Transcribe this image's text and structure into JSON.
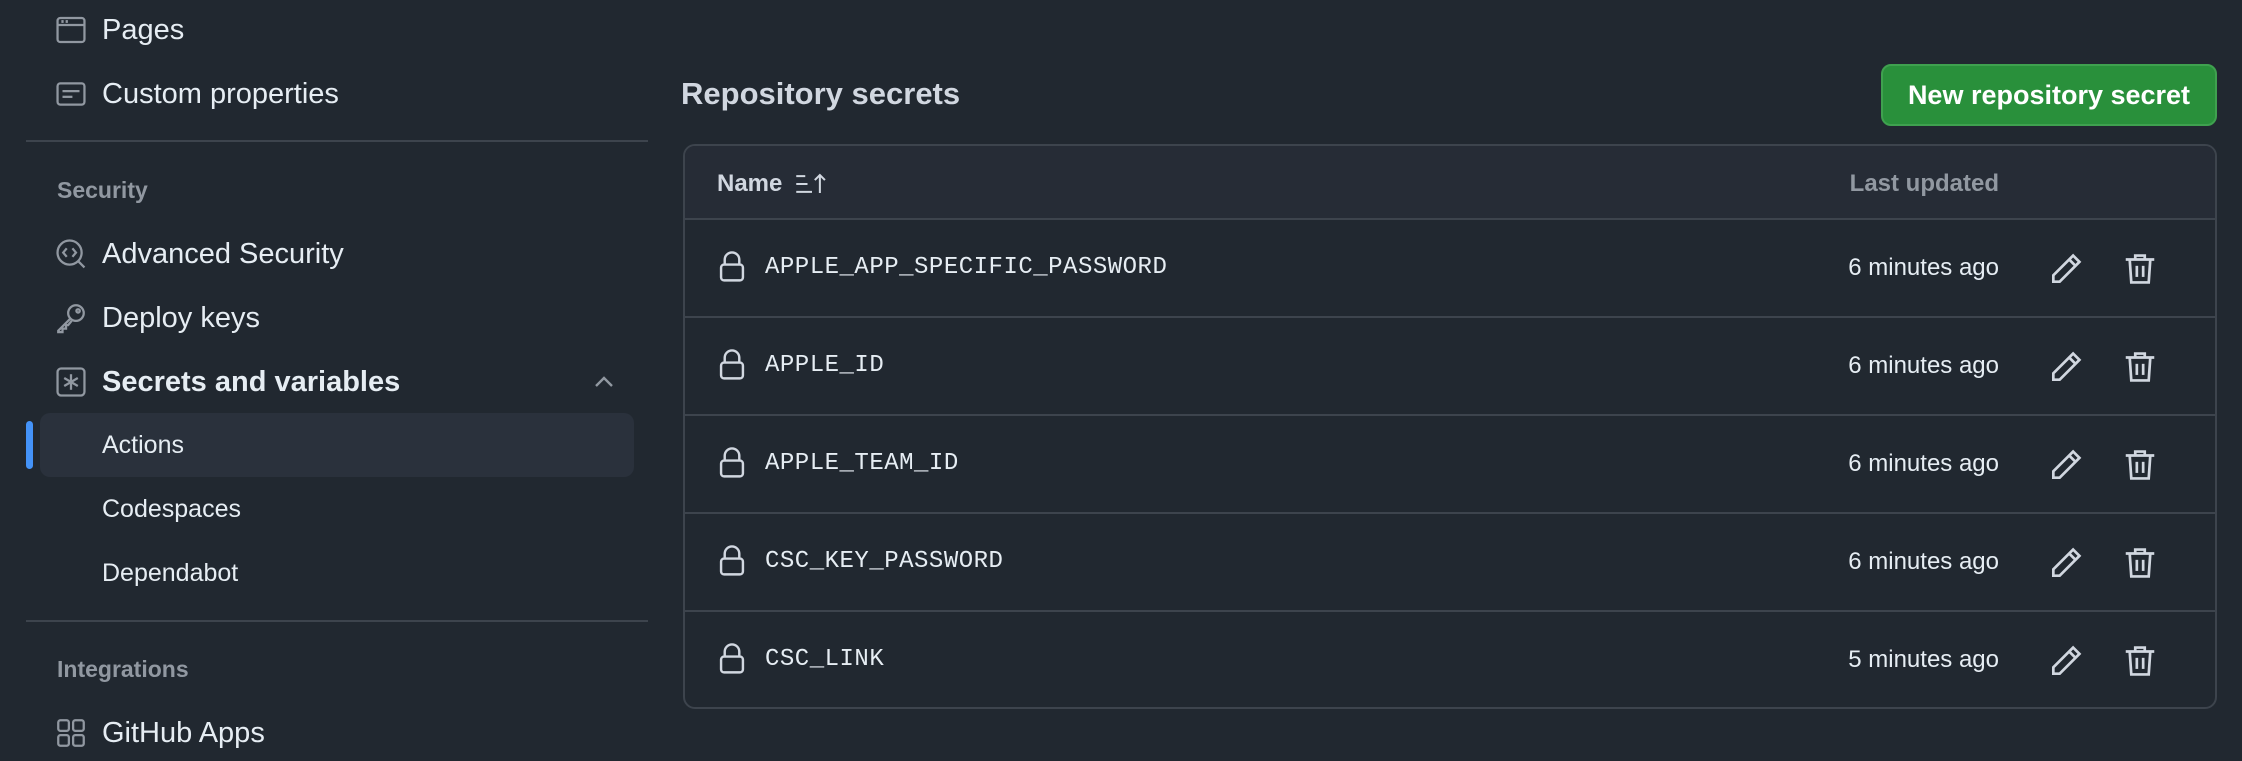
{
  "sidebar": {
    "items_top": [
      {
        "label": "Pages",
        "icon": "browser-window-icon"
      },
      {
        "label": "Custom properties",
        "icon": "note-icon"
      }
    ],
    "security": {
      "heading": "Security",
      "items": [
        {
          "label": "Advanced Security",
          "icon": "codescan-icon"
        },
        {
          "label": "Deploy keys",
          "icon": "key-icon"
        },
        {
          "label": "Secrets and variables",
          "icon": "asterisk-icon",
          "expanded": true
        }
      ],
      "subitems": [
        {
          "label": "Actions",
          "active": true
        },
        {
          "label": "Codespaces",
          "active": false
        },
        {
          "label": "Dependabot",
          "active": false
        }
      ]
    },
    "integrations": {
      "heading": "Integrations",
      "items": [
        {
          "label": "GitHub Apps",
          "icon": "apps-grid-icon"
        }
      ]
    }
  },
  "main": {
    "title": "Repository secrets",
    "new_button_label": "New repository secret",
    "table": {
      "columns": {
        "name": "Name",
        "last_updated": "Last updated"
      },
      "rows": [
        {
          "name": "APPLE_APP_SPECIFIC_PASSWORD",
          "updated": "6 minutes ago"
        },
        {
          "name": "APPLE_ID",
          "updated": "6 minutes ago"
        },
        {
          "name": "APPLE_TEAM_ID",
          "updated": "6 minutes ago"
        },
        {
          "name": "CSC_KEY_PASSWORD",
          "updated": "6 minutes ago"
        },
        {
          "name": "CSC_LINK",
          "updated": "5 minutes ago"
        }
      ]
    }
  },
  "colors": {
    "background": "#212830",
    "accent": "#4493f8",
    "primary_button": "#29903b",
    "border": "#3d444d"
  }
}
